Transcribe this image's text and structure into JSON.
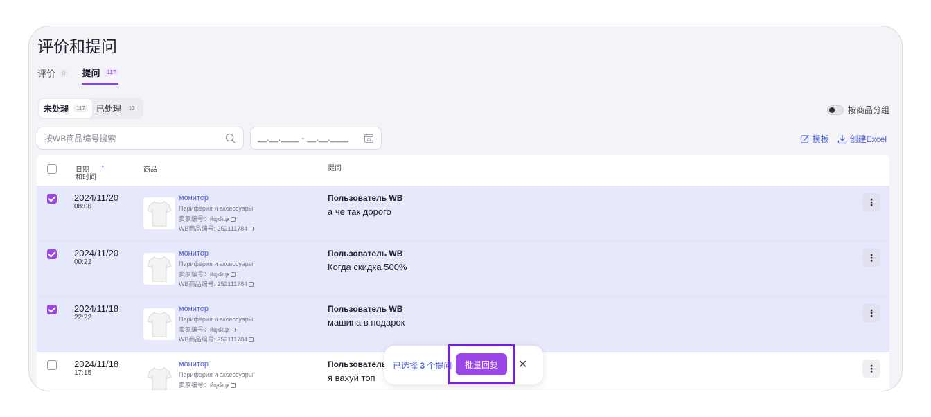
{
  "page": {
    "title": "评价和提问"
  },
  "tabs": [
    {
      "label": "评价",
      "count": "0"
    },
    {
      "label": "提问",
      "count": "117"
    }
  ],
  "subtabs": [
    {
      "label": "未处理",
      "count": "117"
    },
    {
      "label": "已处理",
      "count": "13"
    }
  ],
  "group_toggle": {
    "label": "按商品分组"
  },
  "search": {
    "placeholder": "按WB商品编号搜索"
  },
  "date_range": {
    "value": "__.__.____ - __.__.____"
  },
  "actions": {
    "templates": "模板",
    "create_excel": "创建Excel"
  },
  "table": {
    "headers": {
      "date_line1": "日期",
      "date_line2": "和时间",
      "sort_arrow": "↑",
      "product": "商品",
      "question": "提问"
    },
    "rows": [
      {
        "checked": true,
        "date": "2024/11/20",
        "time": "08:06",
        "product": "монитор",
        "category": "Периферия и аксессуары",
        "seller": "卖家编号：йцкйцк",
        "wb": "WB商品编号: 252111784",
        "user": "Пользователь WB",
        "question": "а че так дорого"
      },
      {
        "checked": true,
        "date": "2024/11/20",
        "time": "00:22",
        "product": "монитор",
        "category": "Периферия и аксессуары",
        "seller": "卖家编号：йцкйцк",
        "wb": "WB商品编号: 252111784",
        "user": "Пользователь WB",
        "question": "Когда скидка 500%"
      },
      {
        "checked": true,
        "date": "2024/11/18",
        "time": "22:22",
        "product": "монитор",
        "category": "Периферия и аксессуары",
        "seller": "卖家编号：йцкйцк",
        "wb": "WB商品编号: 252111784",
        "user": "Пользователь WB",
        "question": "машина в подарок"
      },
      {
        "checked": false,
        "date": "2024/11/18",
        "time": "17:15",
        "product": "монитор",
        "category": "Периферия и аксессуары",
        "seller": "卖家编号：йцкйцк",
        "wb": "",
        "user": "Пользователь",
        "question": "я вахуй топ"
      }
    ]
  },
  "bulk": {
    "prefix": "已选择 ",
    "count": "3",
    "suffix": " 个提问",
    "button": "批量回复",
    "close": "✕"
  },
  "colors": {
    "accent": "#9b46e6",
    "link": "#4d5ed8",
    "selected_row": "#e6e9fb",
    "highlight_border": "#7a1fe0"
  },
  "icons": [
    "search-icon",
    "calendar-icon",
    "edit-icon",
    "download-icon",
    "copy-icon",
    "more-vert-icon",
    "close-icon",
    "tshirt-icon"
  ]
}
